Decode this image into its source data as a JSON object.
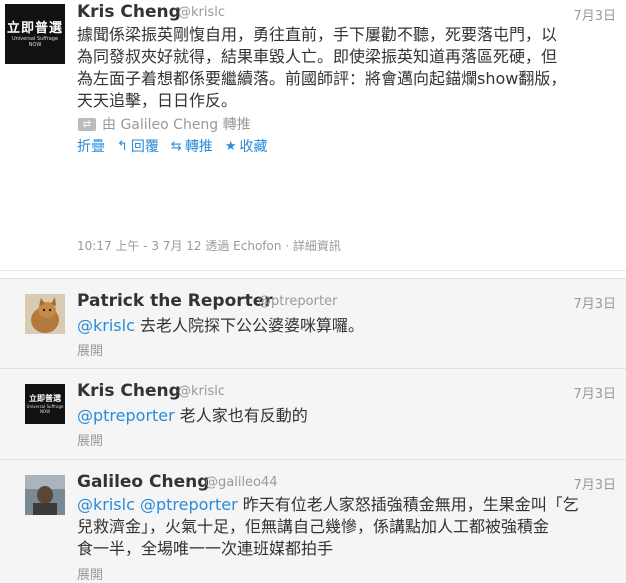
{
  "main": {
    "avatar": {
      "title": "立即普選",
      "sub1": "Universal Suffrage",
      "sub2": "NOW"
    },
    "name": "Kris Cheng",
    "handle": "@krislc",
    "date": "7月3日",
    "text_lines": [
      "據聞係梁振英剛愎自用，勇往直前，手下屢勸不聽，死要落屯門，以",
      "為同發叔夾好就得，結果車毀人亡。即使梁振英知道再落區死硬，但",
      "為左面子着想都係要繼續落。前國師評：將會邁向起錨爛show翻版，",
      "天天追擊，日日作反。"
    ],
    "retweeted_by": "由 Galileo Cheng 轉推",
    "actions": {
      "fold": "折疊",
      "reply": "回覆",
      "retweet": "轉推",
      "favorite": "收藏"
    },
    "meta_time": "10:17 上午 - 3 7月 12 透過 Echofon",
    "meta_sep": " · ",
    "meta_details": "詳細資訊"
  },
  "replies": [
    {
      "name": "Patrick the Reporter",
      "handle": "@ptreporter",
      "date": "7月3日",
      "mentions": [
        "@krislc"
      ],
      "text": " 去老人院探下公公婆婆咪算囉。",
      "expand": "展開"
    },
    {
      "name": "Kris Cheng",
      "handle": "@krislc",
      "date": "7月3日",
      "avatar": {
        "title": "立即普選",
        "sub1": "Universal Suffrage",
        "sub2": "NOW"
      },
      "mentions": [
        "@ptreporter"
      ],
      "text": " 老人家也有反動的",
      "expand": "展開"
    },
    {
      "name": "Galileo Cheng",
      "handle": "@galileo44",
      "date": "7月3日",
      "mentions": [
        "@krislc",
        "@ptreporter"
      ],
      "line1": " 昨天有位老人家怒插強積金無用，生果金叫「乞",
      "line2": "兒救濟金」，火氣十足，佢無講自己幾慘，係講點加人工都被強積金",
      "line3": "食一半，全場唯一一次連班媒都拍手",
      "expand": "展開"
    }
  ],
  "colors": {
    "link": "#2a8bd8",
    "muted": "#999999",
    "reply_bg": "#f5f5f5"
  }
}
